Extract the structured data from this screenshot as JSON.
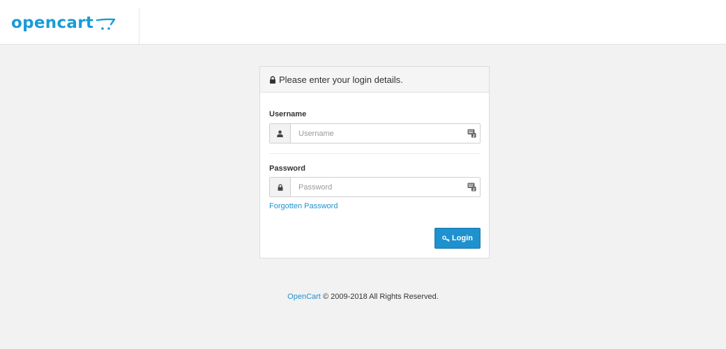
{
  "header": {
    "logo_text": "opencart",
    "logo_color": "#1a9bd7"
  },
  "login_panel": {
    "heading": "Please enter your login details.",
    "heading_icon": "lock-icon",
    "username": {
      "label": "Username",
      "placeholder": "Username",
      "value": "",
      "addon_icon": "user-icon",
      "trailing_icon": "keypass-icon"
    },
    "password": {
      "label": "Password",
      "placeholder": "Password",
      "value": "",
      "addon_icon": "lock-icon",
      "trailing_icon": "keypass-icon"
    },
    "forgotten_link": "Forgotten Password",
    "login_button": {
      "label": "Login",
      "icon": "key-icon",
      "color": "#1e91cf"
    }
  },
  "footer": {
    "brand_link": "OpenCart",
    "copyright": "© 2009-2018 All Rights Reserved."
  },
  "colors": {
    "background": "#f2f2f2",
    "link": "#1e91cf"
  }
}
